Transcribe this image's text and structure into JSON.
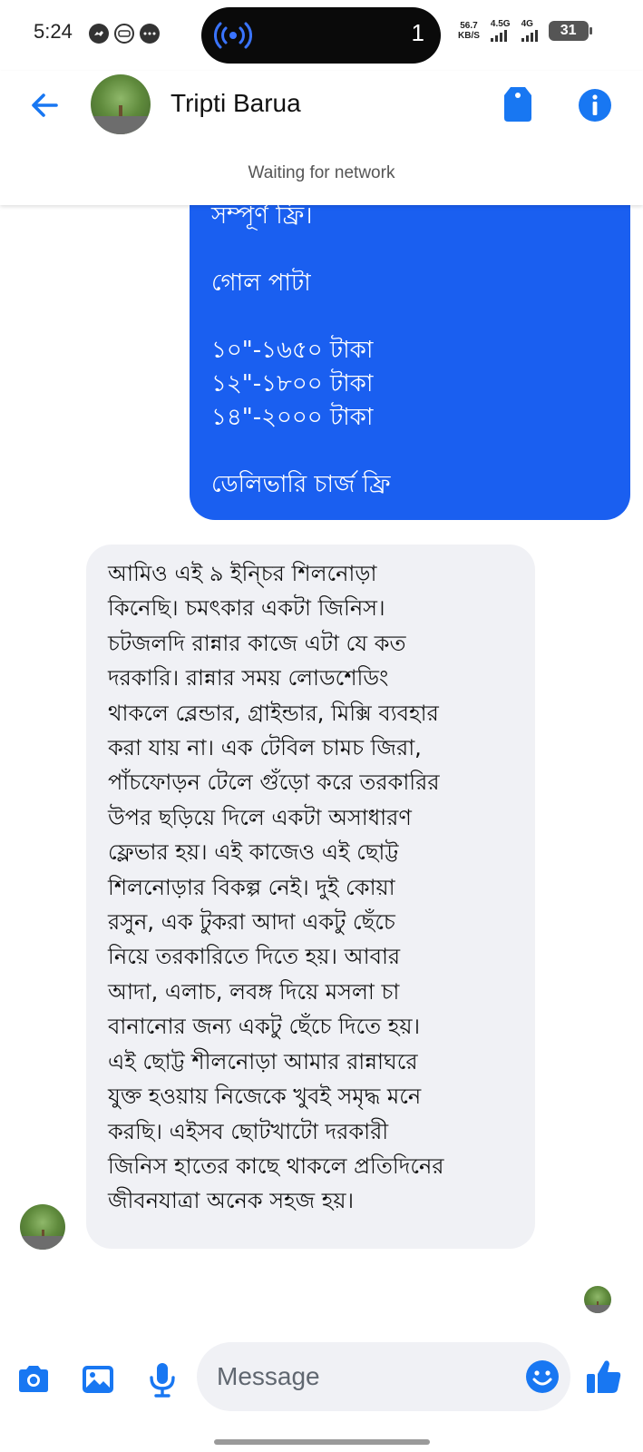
{
  "status_bar": {
    "time": "5:24",
    "island_count": "1",
    "net_speed_value": "56.7",
    "net_speed_unit": "KB/S",
    "sig1_label": "4.5G",
    "sig2_label": "4G",
    "battery": "31"
  },
  "header": {
    "contact_name": "Tripti Barua",
    "network_status": "Waiting for network"
  },
  "messages": {
    "outgoing_lines": [
      "সম্পূর্ণ ফ্রি।",
      "গোল পাটা",
      "১০\"-১৬৫০ টাকা",
      "১২\"-১৮০০ টাকা",
      "১৪\"-২০০০ টাকা",
      "ডেলিভারি চার্জ ফ্রি"
    ],
    "incoming_lines": [
      "আমিও এই ৯ ইন্চির শিলনোড়া",
      "কিনেছি। চমৎকার একটা জিনিস।",
      "চটজলদি রান্নার কাজে এটা যে কত",
      "দরকারি। রান্নার সময় লোডশেডিং",
      "থাকলে ব্লেন্ডার, গ্রাইন্ডার, মিক্সি ব্যবহার",
      "করা যায় না। এক টেবিল চামচ জিরা,",
      "পাঁচফোড়ন টেলে গুঁড়ো করে তরকারির",
      "উপর ছড়িয়ে দিলে একটা অসাধারণ",
      "ফ্লেভার হয়। এই কাজেও এই ছোট্ট",
      "শিলনোড়ার বিকল্প নেই। দুই কোয়া",
      "রসুন, এক টুকরা আদা একটু ছেঁচে",
      "নিয়ে তরকারিতে দিতে হয়। আবার",
      "আদা, এলাচ, লবঙ্গ দিয়ে মসলা চা",
      "বানানোর জন্য একটু ছেঁচে দিতে হয়।",
      "এই ছোট্ট শীলনোড়া আমার রান্নাঘরে",
      "যুক্ত হওয়ায় নিজেকে খুবই সমৃদ্ধ মনে",
      "করছি। এইসব ছোটখাটো দরকারী",
      "জিনিস হাতের কাছে থাকলে প্রতিদিনের",
      "জীবনযাত্রা অনেক সহজ হয়।"
    ]
  },
  "composer": {
    "placeholder": "Message"
  },
  "colors": {
    "accent": "#1877f2",
    "outgoing_bubble": "#1a5ff0",
    "incoming_bubble": "#f0f1f5"
  },
  "icons": {
    "back": "arrow-left-icon",
    "tag": "tag-icon",
    "info": "info-icon",
    "camera": "camera-icon",
    "gallery": "image-icon",
    "mic": "microphone-icon",
    "emoji": "emoji-icon",
    "like": "thumbs-up-icon"
  }
}
